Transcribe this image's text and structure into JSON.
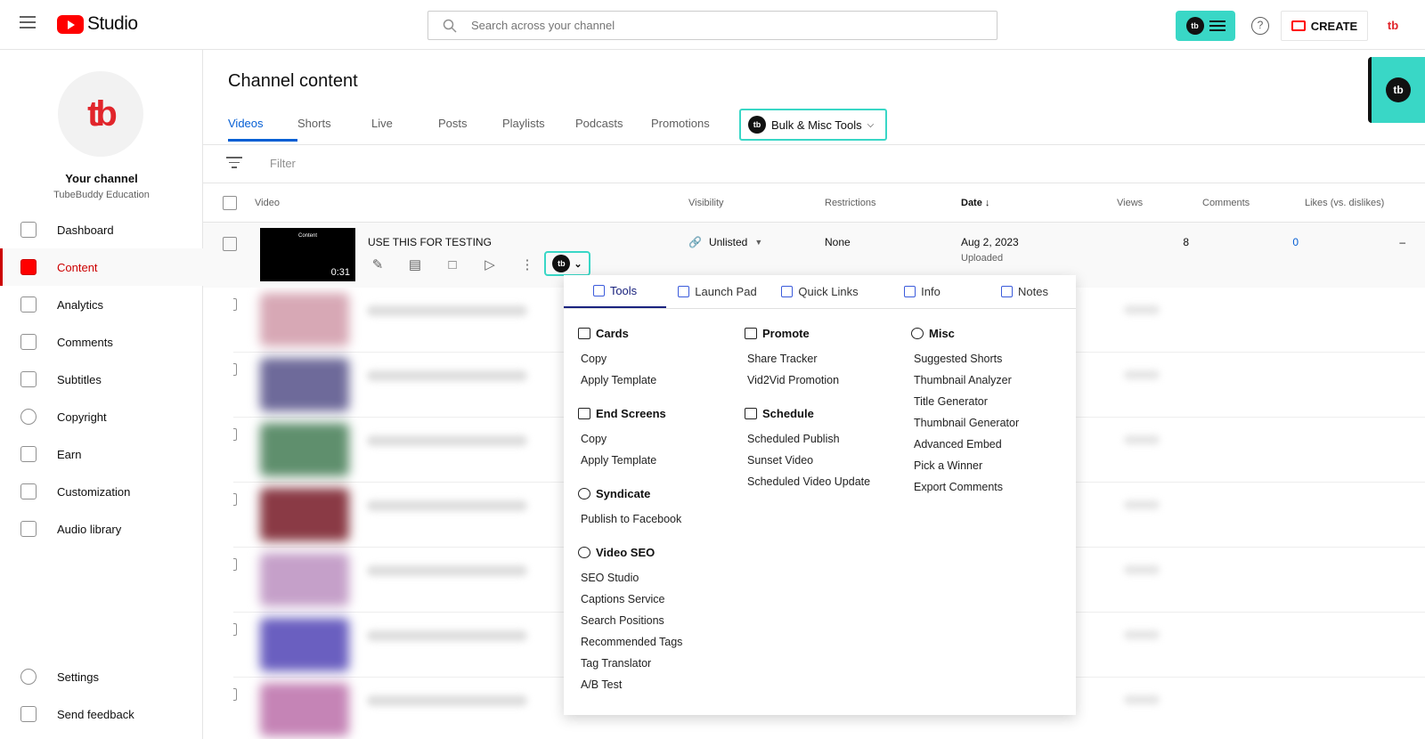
{
  "app": {
    "title": "Studio"
  },
  "search": {
    "placeholder": "Search across your channel"
  },
  "header": {
    "create_label": "CREATE",
    "help_label": "?",
    "tb_logo": "tb"
  },
  "channel": {
    "name": "Your channel",
    "subtitle": "TubeBuddy Education",
    "avatar_text": "tb"
  },
  "sidebar": {
    "items": [
      {
        "label": "Dashboard",
        "icon": "dashboard-icon"
      },
      {
        "label": "Content",
        "icon": "content-icon",
        "active": true
      },
      {
        "label": "Analytics",
        "icon": "analytics-icon"
      },
      {
        "label": "Comments",
        "icon": "comments-icon"
      },
      {
        "label": "Subtitles",
        "icon": "subtitles-icon"
      },
      {
        "label": "Copyright",
        "icon": "copyright-icon"
      },
      {
        "label": "Earn",
        "icon": "dollar-icon"
      },
      {
        "label": "Customization",
        "icon": "wand-icon"
      },
      {
        "label": "Audio library",
        "icon": "audio-library-icon"
      }
    ],
    "bottom": [
      {
        "label": "Settings",
        "icon": "gear-icon"
      },
      {
        "label": "Send feedback",
        "icon": "feedback-icon"
      }
    ]
  },
  "page": {
    "title": "Channel content"
  },
  "tabs": [
    "Videos",
    "Shorts",
    "Live",
    "Posts",
    "Playlists",
    "Podcasts",
    "Promotions"
  ],
  "bulk_tools": {
    "label": "Bulk & Misc Tools"
  },
  "filter": {
    "placeholder": "Filter"
  },
  "table": {
    "columns": {
      "video": "Video",
      "visibility": "Visibility",
      "restrictions": "Restrictions",
      "date": "Date",
      "views": "Views",
      "comments": "Comments",
      "likes": "Likes (vs. dislikes)"
    },
    "row": {
      "thumb_text": "Content",
      "duration": "0:31",
      "title": "USE THIS FOR TESTING",
      "visibility": "Unlisted",
      "restrictions": "None",
      "date": "Aug 2, 2023",
      "date_status": "Uploaded",
      "views": "8",
      "comments": "0",
      "likes": "–"
    }
  },
  "dropdown": {
    "tabs": [
      "Tools",
      "Launch Pad",
      "Quick Links",
      "Info",
      "Notes"
    ],
    "col1": [
      {
        "heading": "Cards",
        "items": [
          "Copy",
          "Apply Template"
        ]
      },
      {
        "heading": "End Screens",
        "items": [
          "Copy",
          "Apply Template"
        ]
      },
      {
        "heading": "Syndicate",
        "items": [
          "Publish to Facebook"
        ]
      },
      {
        "heading": "Video SEO",
        "items": [
          "SEO Studio",
          "Captions Service",
          "Search Positions",
          "Recommended Tags",
          "Tag Translator",
          "A/B Test"
        ]
      }
    ],
    "col2": [
      {
        "heading": "Promote",
        "items": [
          "Share Tracker",
          "Vid2Vid Promotion"
        ]
      },
      {
        "heading": "Schedule",
        "items": [
          "Scheduled Publish",
          "Sunset Video",
          "Scheduled Video Update"
        ]
      }
    ],
    "col3": [
      {
        "heading": "Misc",
        "items": [
          "Suggested Shorts",
          "Thumbnail Analyzer",
          "Title Generator",
          "Thumbnail Generator",
          "Advanced Embed",
          "Pick a Winner",
          "Export Comments"
        ]
      }
    ]
  },
  "colors": {
    "accent": "#39d7c6",
    "brand_red": "#ff0000",
    "link_blue": "#065fd4"
  }
}
